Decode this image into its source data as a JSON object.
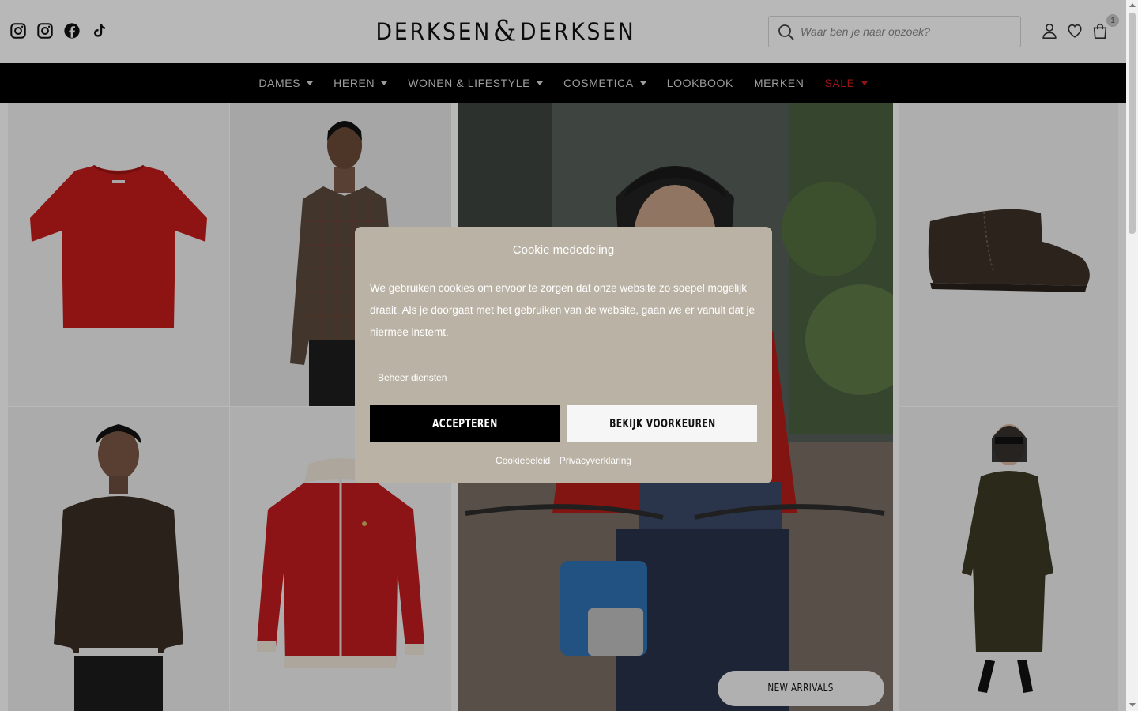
{
  "header": {
    "logo": {
      "left": "DERKSEN",
      "amp": "&",
      "right": "DERKSEN"
    },
    "search": {
      "placeholder": "Waar ben je naar opzoek?",
      "value": ""
    },
    "cart": {
      "count": "1"
    },
    "social": [
      "instagram-icon",
      "instagram-icon",
      "facebook-icon",
      "tiktok-icon"
    ]
  },
  "nav": {
    "items": [
      {
        "label": "DAMES",
        "dropdown": true
      },
      {
        "label": "HEREN",
        "dropdown": true
      },
      {
        "label": "WONEN & LIFESTYLE",
        "dropdown": true
      },
      {
        "label": "COSMETICA",
        "dropdown": true
      },
      {
        "label": "LOOKBOOK",
        "dropdown": false
      },
      {
        "label": "MERKEN",
        "dropdown": false
      },
      {
        "label": "SALE",
        "dropdown": true
      }
    ],
    "sale_color": "#d21d1d"
  },
  "hero": {
    "cta": "NEW ARRIVALS"
  },
  "cookie": {
    "title": "Cookie mededeling",
    "body": "We gebruiken cookies om ervoor te zorgen dat onze website zo soepel mogelijk draait. Als je doorgaat met het gebruiken van de website, gaan we er vanuit dat je hiermee instemt.",
    "manage": "Beheer diensten",
    "accept": "ACCEPTEREN",
    "preferences": "BEKIJK VOORKEUREN",
    "links": {
      "cookie_policy": "Cookiebeleid",
      "privacy": "Privacyverklaring"
    },
    "bg_color": "#bab2a4"
  }
}
